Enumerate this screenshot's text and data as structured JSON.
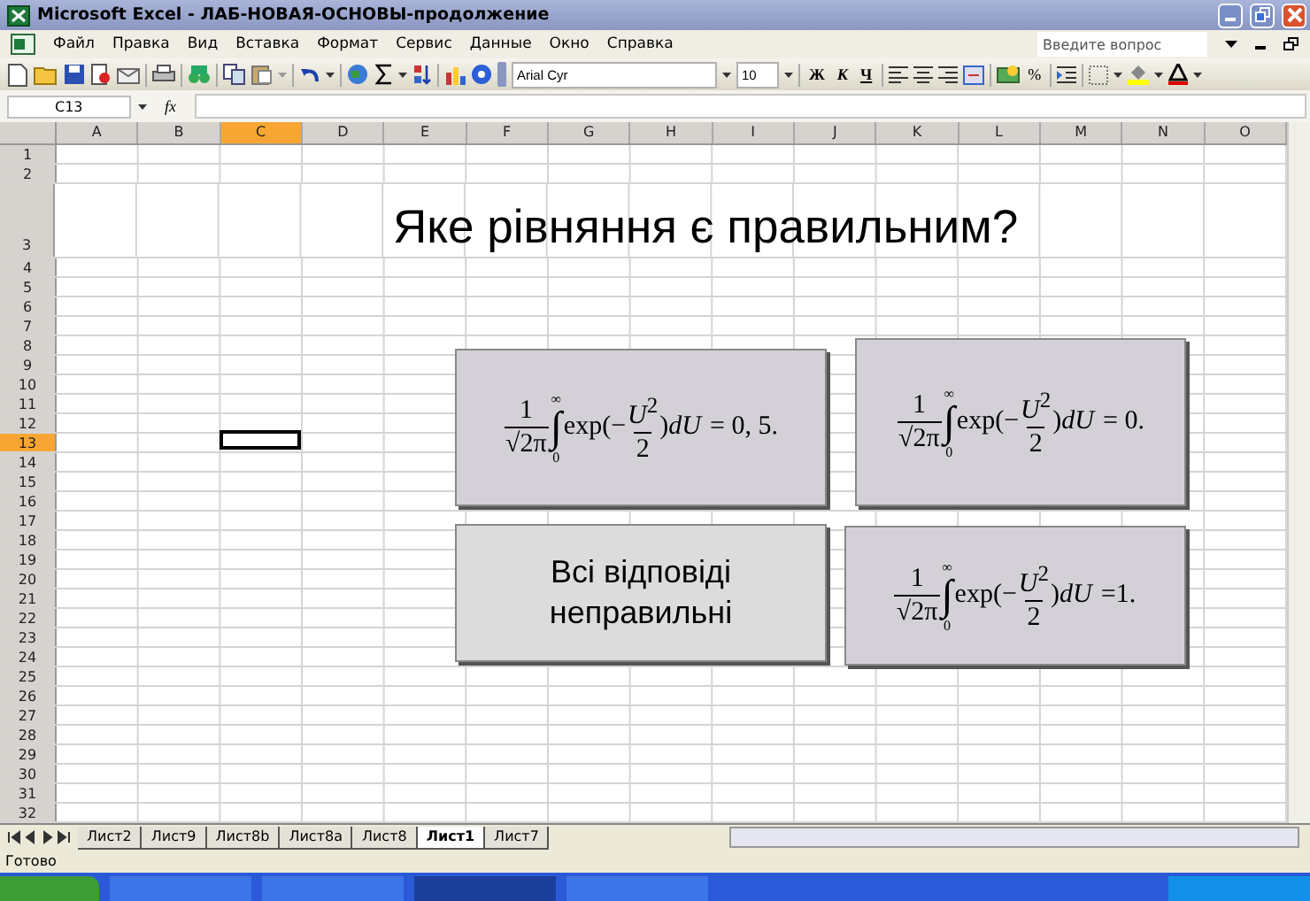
{
  "window": {
    "title": "Microsoft Excel - ЛАБ-НОВАЯ-ОСНОВЫ-продолжение"
  },
  "menu": [
    "Файл",
    "Правка",
    "Вид",
    "Вставка",
    "Формат",
    "Сервис",
    "Данные",
    "Окно",
    "Справка"
  ],
  "help_box": {
    "placeholder": "Введите вопрос"
  },
  "formatting": {
    "font": "Arial Cyr",
    "size": "10",
    "bold": "Ж",
    "italic": "К",
    "underline": "Ч",
    "percent": "%"
  },
  "formula_bar": {
    "name_box": "C13",
    "fx": "fx"
  },
  "columns": [
    {
      "label": "A",
      "selected": false
    },
    {
      "label": "B",
      "selected": false
    },
    {
      "label": "C",
      "selected": true
    },
    {
      "label": "D",
      "selected": false
    },
    {
      "label": "E",
      "selected": false
    },
    {
      "label": "F",
      "selected": false
    },
    {
      "label": "G",
      "selected": false
    },
    {
      "label": "H",
      "selected": false
    },
    {
      "label": "I",
      "selected": false
    },
    {
      "label": "J",
      "selected": false
    },
    {
      "label": "K",
      "selected": false
    },
    {
      "label": "L",
      "selected": false
    },
    {
      "label": "M",
      "selected": false
    },
    {
      "label": "N",
      "selected": false
    },
    {
      "label": "O",
      "selected": false
    }
  ],
  "rows": [
    {
      "label": "1",
      "selected": false
    },
    {
      "label": "2",
      "selected": false
    },
    {
      "label": "3",
      "selected": false
    },
    {
      "label": "4",
      "selected": false
    },
    {
      "label": "5",
      "selected": false
    },
    {
      "label": "6",
      "selected": false
    },
    {
      "label": "7",
      "selected": false
    },
    {
      "label": "8",
      "selected": false
    },
    {
      "label": "9",
      "selected": false
    },
    {
      "label": "10",
      "selected": false
    },
    {
      "label": "11",
      "selected": false
    },
    {
      "label": "12",
      "selected": false
    },
    {
      "label": "13",
      "selected": true
    },
    {
      "label": "14",
      "selected": false
    },
    {
      "label": "15",
      "selected": false
    },
    {
      "label": "16",
      "selected": false
    },
    {
      "label": "17",
      "selected": false
    },
    {
      "label": "18",
      "selected": false
    },
    {
      "label": "19",
      "selected": false
    },
    {
      "label": "20",
      "selected": false
    },
    {
      "label": "21",
      "selected": false
    },
    {
      "label": "22",
      "selected": false
    },
    {
      "label": "23",
      "selected": false
    },
    {
      "label": "24",
      "selected": false
    },
    {
      "label": "25",
      "selected": false
    },
    {
      "label": "26",
      "selected": false
    },
    {
      "label": "27",
      "selected": false
    },
    {
      "label": "28",
      "selected": false
    },
    {
      "label": "29",
      "selected": false
    },
    {
      "label": "30",
      "selected": false
    },
    {
      "label": "31",
      "selected": false
    },
    {
      "label": "32",
      "selected": false
    }
  ],
  "heading": "Яке рівняння є правильним?",
  "options": [
    {
      "kind": "formula",
      "coef_num": "1",
      "coef_den": "√2π",
      "integral": "∫",
      "upper": "∞",
      "lower": "0",
      "func": "exp(−",
      "exp_num": "*U*$^{2}$",
      "exp_den": "2",
      "tail": ")*dU*",
      "result": "= 0, 5."
    },
    {
      "kind": "formula",
      "coef_num": "1",
      "coef_den": "√2π",
      "integral": "∫",
      "upper": "∞",
      "lower": "0",
      "func": "exp(−",
      "exp_num": "*U*$^{2}$",
      "exp_den": "2",
      "tail": ")*dU*",
      "result": "= 0."
    },
    {
      "kind": "text",
      "text": "Всі відповіді неправильні"
    },
    {
      "kind": "formula",
      "coef_num": "1",
      "coef_den": "√2π",
      "integral": "∫",
      "upper": "∞",
      "lower": "0",
      "func": "exp(−",
      "exp_num": "*U*$^{2}$",
      "exp_den": "2",
      "tail": ")*dU*",
      "result": "=1."
    }
  ],
  "sheet_tabs": [
    {
      "label": "Лист2",
      "selected": false
    },
    {
      "label": "Лист9",
      "selected": false
    },
    {
      "label": "Лист8b",
      "selected": false
    },
    {
      "label": "Лист8a",
      "selected": false
    },
    {
      "label": "Лист8",
      "selected": false
    },
    {
      "label": "Лист1",
      "selected": true
    },
    {
      "label": "Лист7",
      "selected": false
    }
  ],
  "status_bar": "Готово"
}
